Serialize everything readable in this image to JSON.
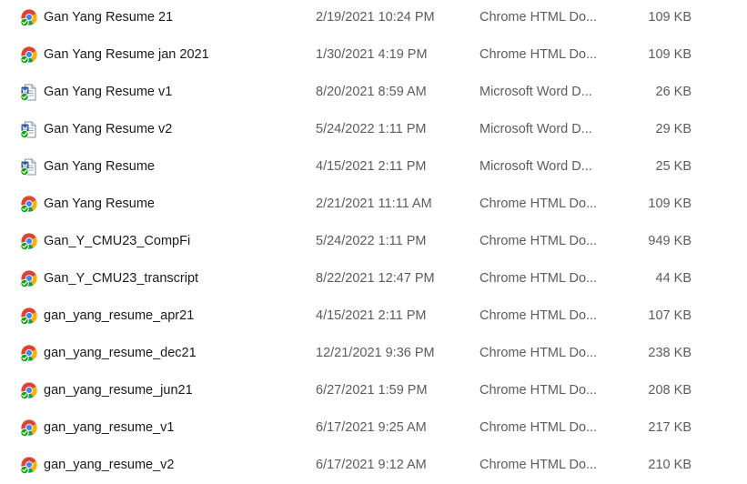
{
  "files": [
    {
      "name": "Gan Yang Resume 21",
      "date": "2/19/2021 10:24 PM",
      "type": "Chrome HTML Do...",
      "size": "109 KB",
      "icon": "chrome-html-icon"
    },
    {
      "name": "Gan Yang Resume jan 2021",
      "date": "1/30/2021 4:19 PM",
      "type": "Chrome HTML Do...",
      "size": "109 KB",
      "icon": "chrome-html-icon"
    },
    {
      "name": "Gan Yang Resume v1",
      "date": "8/20/2021 8:59 AM",
      "type": "Microsoft Word D...",
      "size": "26 KB",
      "icon": "word-document-icon"
    },
    {
      "name": "Gan Yang Resume v2",
      "date": "5/24/2022 1:11 PM",
      "type": "Microsoft Word D...",
      "size": "29 KB",
      "icon": "word-document-icon"
    },
    {
      "name": "Gan Yang Resume",
      "date": "4/15/2021 2:11 PM",
      "type": "Microsoft Word D...",
      "size": "25 KB",
      "icon": "word-document-icon"
    },
    {
      "name": "Gan Yang Resume",
      "date": "2/21/2021 11:11 AM",
      "type": "Chrome HTML Do...",
      "size": "109 KB",
      "icon": "chrome-html-icon"
    },
    {
      "name": "Gan_Y_CMU23_CompFi",
      "date": "5/24/2022 1:11 PM",
      "type": "Chrome HTML Do...",
      "size": "949 KB",
      "icon": "chrome-html-icon"
    },
    {
      "name": "Gan_Y_CMU23_transcript",
      "date": "8/22/2021 12:47 PM",
      "type": "Chrome HTML Do...",
      "size": "44 KB",
      "icon": "chrome-html-icon"
    },
    {
      "name": "gan_yang_resume_apr21",
      "date": "4/15/2021 2:11 PM",
      "type": "Chrome HTML Do...",
      "size": "107 KB",
      "icon": "chrome-html-icon"
    },
    {
      "name": "gan_yang_resume_dec21",
      "date": "12/21/2021 9:36 PM",
      "type": "Chrome HTML Do...",
      "size": "238 KB",
      "icon": "chrome-html-icon"
    },
    {
      "name": "gan_yang_resume_jun21",
      "date": "6/27/2021 1:59 PM",
      "type": "Chrome HTML Do...",
      "size": "208 KB",
      "icon": "chrome-html-icon"
    },
    {
      "name": "gan_yang_resume_v1",
      "date": "6/17/2021 9:25 AM",
      "type": "Chrome HTML Do...",
      "size": "217 KB",
      "icon": "chrome-html-icon"
    },
    {
      "name": "gan_yang_resume_v2",
      "date": "6/17/2021 9:12 AM",
      "type": "Chrome HTML Do...",
      "size": "210 KB",
      "icon": "chrome-html-icon"
    }
  ],
  "colors": {
    "chrome_red": "#db4437",
    "chrome_yellow": "#f4b400",
    "chrome_green": "#0f9d58",
    "chrome_blue": "#4285f4",
    "word_blue": "#2b579a",
    "sync_check_green": "#13a10e",
    "secondary_text": "#5c5c5c"
  }
}
